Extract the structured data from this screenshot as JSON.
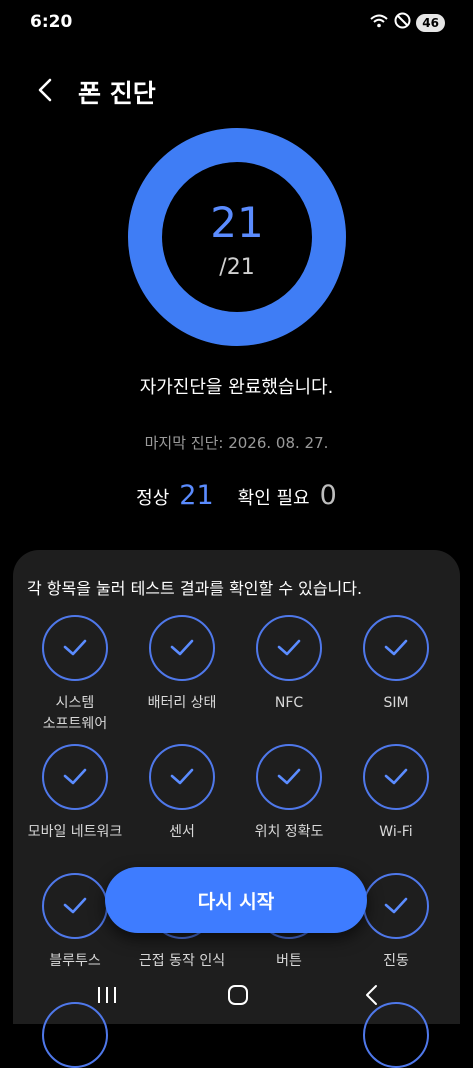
{
  "status": {
    "time": "6:20",
    "battery": "46"
  },
  "header": {
    "title": "폰 진단"
  },
  "summary_ring": {
    "count": "21",
    "total": "/21",
    "fraction_complete": 1.0
  },
  "result": {
    "complete_text": "자가진단을 완료했습니다.",
    "last_diagnosis": "마지막 진단: 2026. 08. 27.",
    "normal_label": "정상",
    "normal_count": "21",
    "needs_check_label": "확인 필요",
    "needs_check_count": "0"
  },
  "panel": {
    "hint": "각 항목을 눌러 테스트 결과를 확인할 수 있습니다.",
    "tiles": [
      {
        "label": "시스템\n소프트웨어"
      },
      {
        "label": "배터리 상태"
      },
      {
        "label": "NFC"
      },
      {
        "label": "SIM"
      },
      {
        "label": "모바일 네트워크"
      },
      {
        "label": "센서"
      },
      {
        "label": "위치 정확도"
      },
      {
        "label": "Wi-Fi"
      },
      {
        "label": "블루투스"
      },
      {
        "label": "근접 동작 인식"
      },
      {
        "label": "버튼"
      },
      {
        "label": "진동"
      }
    ]
  },
  "cta": {
    "label": "다시 시작"
  },
  "colors": {
    "accent": "#3e7cff",
    "ring": "#3f7df5",
    "panel": "#1e1e1e"
  }
}
